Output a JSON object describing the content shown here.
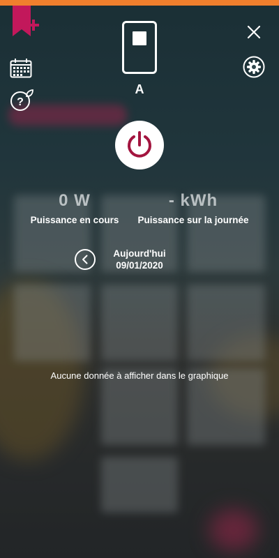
{
  "colors": {
    "accent_orange": "#f07f2d",
    "brand_pink": "#c2185b",
    "power_red": "#a3153f"
  },
  "header": {
    "device_name": "A",
    "icons": [
      "bookmark-plus-icon",
      "calendar-icon",
      "help-leaf-icon",
      "close-icon",
      "gear-icon",
      "device-switch-icon"
    ]
  },
  "power": {
    "icon": "power-icon"
  },
  "stats": {
    "current_value": "0 W",
    "current_label": "Puissance en cours",
    "daily_value": "- kWh",
    "daily_label": "Puissance sur la journée"
  },
  "date": {
    "day_label": "Aujourd'hui",
    "date_value": "09/01/2020",
    "prev_icon": "chevron-left-icon"
  },
  "chart": {
    "empty_message": "Aucune donnée à afficher dans le graphique"
  }
}
